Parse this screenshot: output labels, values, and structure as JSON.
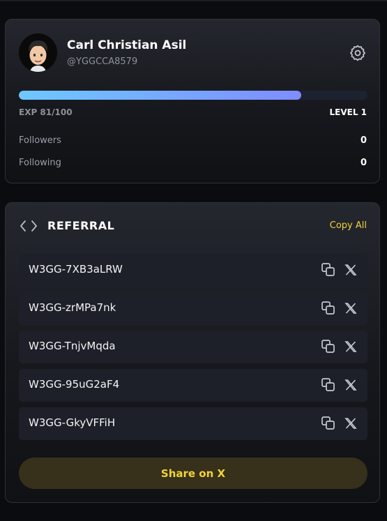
{
  "profile": {
    "name": "Carl Christian Asil",
    "handle": "@YGGCCA8579",
    "exp_label": "EXP 81/100",
    "exp_fraction": 0.81,
    "level_label": "LEVEL 1",
    "stats": [
      {
        "label": "Followers",
        "value": "0"
      },
      {
        "label": "Following",
        "value": "0"
      }
    ]
  },
  "referral": {
    "title": "REFERRAL",
    "copy_all_label": "Copy All",
    "codes": [
      "W3GG-7XB3aLRW",
      "W3GG-zrMPa7nk",
      "W3GG-TnjvMqda",
      "W3GG-95uG2aF4",
      "W3GG-GkyVFFiH"
    ],
    "share_label": "Share on X"
  },
  "icons": {
    "settings": "gear-icon",
    "code": "code-brackets-icon",
    "copy": "copy-icon",
    "x": "x-logo-icon"
  },
  "colors": {
    "accent_yellow": "#f2d33a",
    "exp_gradient_start": "#6ec8ff",
    "exp_gradient_end": "#7f8cff"
  }
}
